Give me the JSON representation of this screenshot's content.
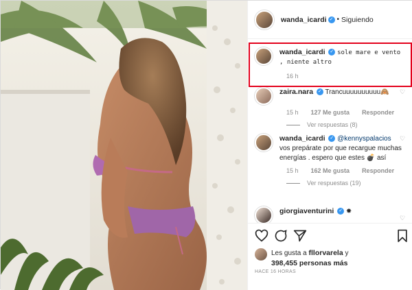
{
  "header": {
    "username": "wanda_icardi",
    "separator": "•",
    "follow_label": "Siguiendo"
  },
  "comments": [
    {
      "username": "wanda_icardi",
      "text": "sole mare e vento , niente altro",
      "time": "16 h"
    },
    {
      "username": "zaira.nara",
      "text": "Trancuuuuuuuuuu🙈",
      "time": "15 h",
      "likes": "127 Me gusta",
      "reply_label": "Responder",
      "replies_label": "Ver respuestas (8)"
    },
    {
      "username": "wanda_icardi",
      "mention": "@kennyspalacios",
      "text": "vos prepárate por que recargue muchas energías . espero que estes 💣 así",
      "time": "15 h",
      "likes": "162 Me gusta",
      "reply_label": "Responder",
      "replies_label": "Ver respuestas (19)"
    },
    {
      "username": "giorgiaventurini",
      "text": "✸"
    }
  ],
  "likes": {
    "prefix": "Les gusta a",
    "user": "fllorvarela",
    "conj": "y",
    "count": "398,455 personas más"
  },
  "timestamp": "HACE 16 HORAS",
  "colors": {
    "highlight": "#e3001b",
    "verified": "#3897f0",
    "muted": "#8e8e8e"
  }
}
